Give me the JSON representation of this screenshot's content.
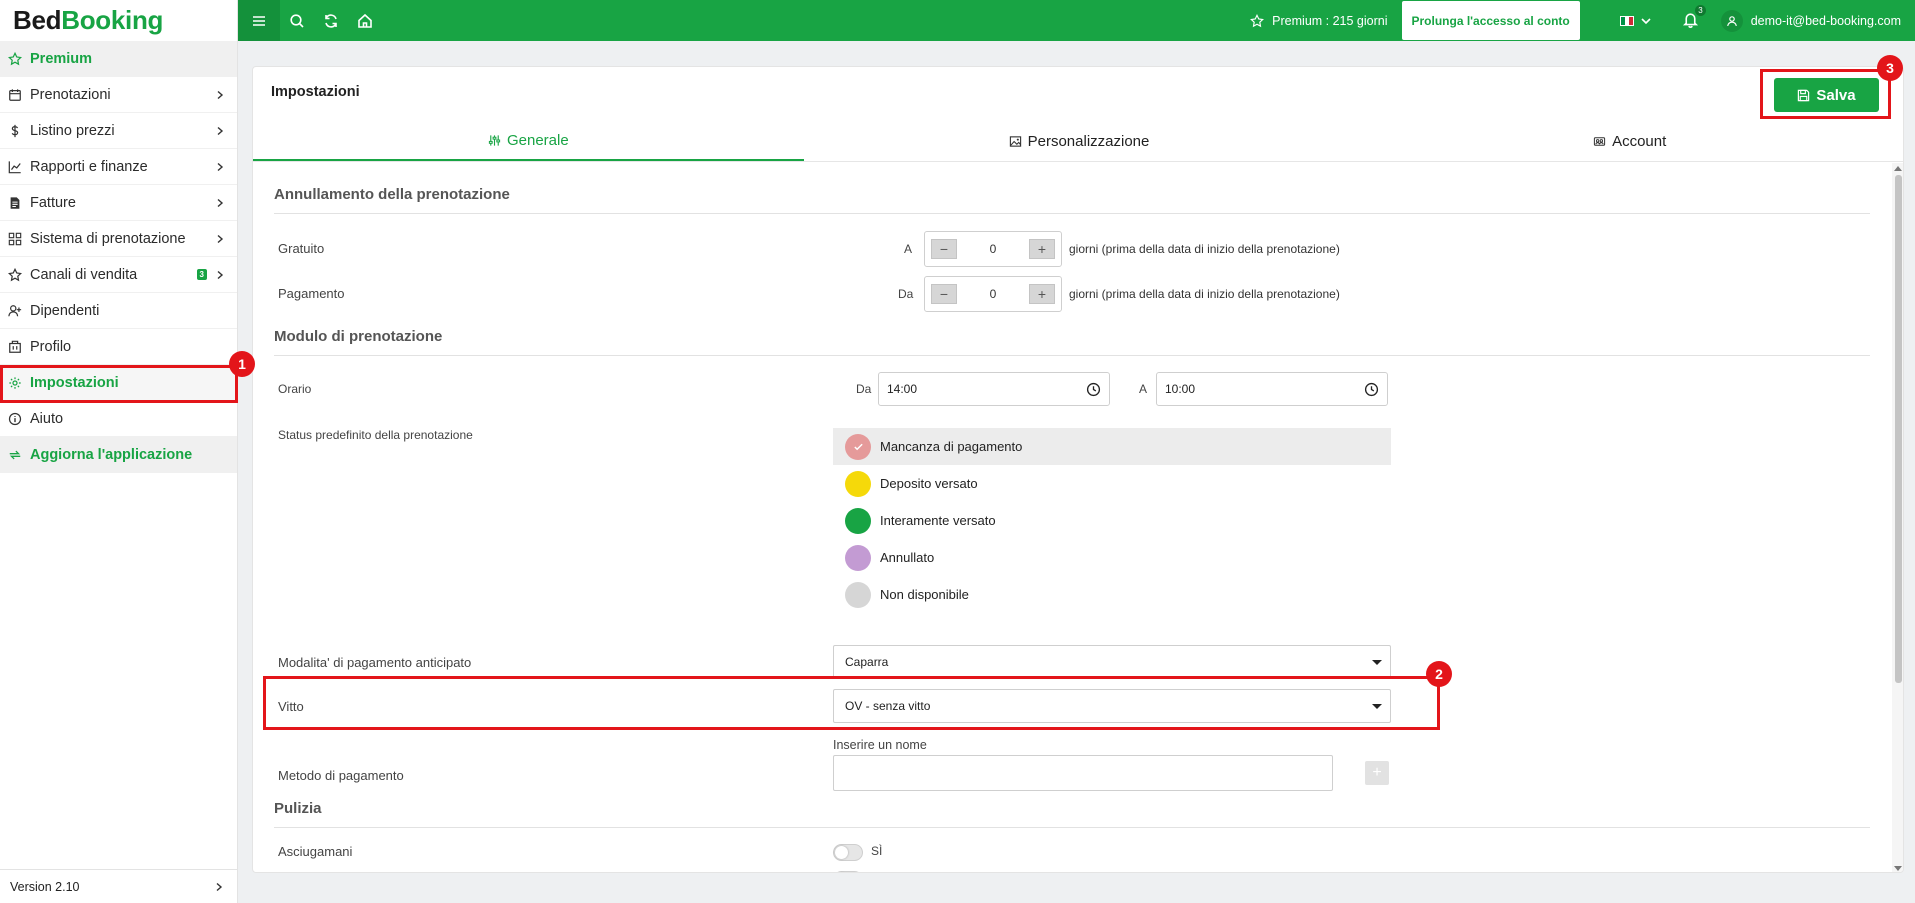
{
  "app": {
    "logo_part1": "Bed",
    "logo_part2": "Booking"
  },
  "sidebar": {
    "items": [
      {
        "label": "Premium",
        "icon": "star-icon"
      },
      {
        "label": "Prenotazioni",
        "icon": "calendar-icon"
      },
      {
        "label": "Listino prezzi",
        "icon": "dollar-icon"
      },
      {
        "label": "Rapporti e finanze",
        "icon": "chart-icon"
      },
      {
        "label": "Fatture",
        "icon": "invoice-icon"
      },
      {
        "label": "Sistema di prenotazione",
        "icon": "grid-icon"
      },
      {
        "label": "Canali di vendita",
        "icon": "star-outline-icon",
        "badge": "3"
      },
      {
        "label": "Dipendenti",
        "icon": "user-plus-icon"
      },
      {
        "label": "Profilo",
        "icon": "building-icon"
      },
      {
        "label": "Impostazioni",
        "icon": "gear-icon"
      },
      {
        "label": "Aiuto",
        "icon": "info-icon"
      },
      {
        "label": "Aggiorna l'applicazione",
        "icon": "refresh-icon"
      }
    ],
    "footer_version": "Version 2.10"
  },
  "topbar": {
    "premium_text": "Premium : 215 giorni",
    "extend_button": "Prolunga l'accesso al conto",
    "notification_count": "3",
    "user_email": "demo-it@bed-booking.com",
    "flag_colors": [
      "#009246",
      "#ffffff",
      "#ce2b37"
    ]
  },
  "page": {
    "title": "Impostazioni",
    "save_label": "Salva",
    "tabs": [
      {
        "label": "Generale",
        "active": true
      },
      {
        "label": "Personalizzazione",
        "active": false
      },
      {
        "label": "Account",
        "active": false
      }
    ]
  },
  "cancellation": {
    "section_title": "Annullamento della prenotazione",
    "free_label": "Gratuito",
    "free_prefix": "A",
    "free_value": "0",
    "free_suffix": "giorni (prima della data di inizio della prenotazione)",
    "paid_label": "Pagamento",
    "paid_prefix": "Da",
    "paid_value": "0",
    "paid_suffix": "giorni (prima della data di inizio della prenotazione)"
  },
  "booking_form": {
    "section_title": "Modulo di prenotazione",
    "time_label": "Orario",
    "from_prefix": "Da",
    "from_value": "14:00",
    "to_prefix": "A",
    "to_value": "10:00",
    "status_label": "Status predefinito della prenotazione",
    "statuses": [
      {
        "label": "Mancanza di pagamento",
        "color": "#e59a9a",
        "selected": true
      },
      {
        "label": "Deposito versato",
        "color": "#f5d90a",
        "selected": false
      },
      {
        "label": "Interamente versato",
        "color": "#18a444",
        "selected": false
      },
      {
        "label": "Annullato",
        "color": "#c39bd3",
        "selected": false
      },
      {
        "label": "Non disponibile",
        "color": "#d6d6d6",
        "selected": false
      }
    ],
    "advance_payment_label": "Modalita' di pagamento anticipato",
    "advance_payment_value": "Caparra",
    "board_label": "Vitto",
    "board_value": "OV - senza vitto",
    "payment_method_label": "Metodo di pagamento",
    "payment_method_hint": "Inserire un nome",
    "payment_method_value": ""
  },
  "cleaning": {
    "section_title": "Pulizia",
    "towels_label": "Asciugamani",
    "towels_toggle_text": "SÌ"
  },
  "annotations": [
    "1",
    "2",
    "3"
  ],
  "colors": {
    "brand_green": "#18a444",
    "annotation_red": "#e3151a"
  }
}
